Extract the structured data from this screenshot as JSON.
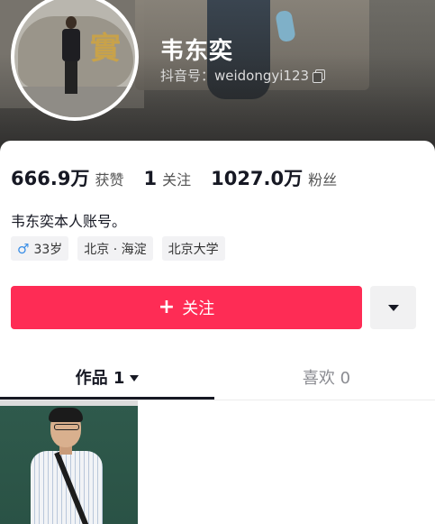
{
  "profile": {
    "name": "韦东奕",
    "account_id": "抖音号：weidongyi123",
    "avatar_char": "實"
  },
  "stats": [
    {
      "value": "666.9万",
      "label": "获赞"
    },
    {
      "value": "1",
      "label": "关注"
    },
    {
      "value": "1027.0万",
      "label": "粉丝"
    }
  ],
  "bio": "韦东奕本人账号。",
  "tags": {
    "gender_age": "33岁",
    "location": "北京 · 海淀",
    "school": "北京大学"
  },
  "actions": {
    "follow_label": "关注"
  },
  "tabs": {
    "works": "作品 1",
    "likes": "喜欢 0"
  },
  "colors": {
    "follow_button": "#fe2c55",
    "male_icon": "#3a8ee6"
  },
  "icons": {
    "copy": "copy-icon",
    "male": "male-icon",
    "plus": "plus-icon",
    "more": "caret-down-icon"
  }
}
